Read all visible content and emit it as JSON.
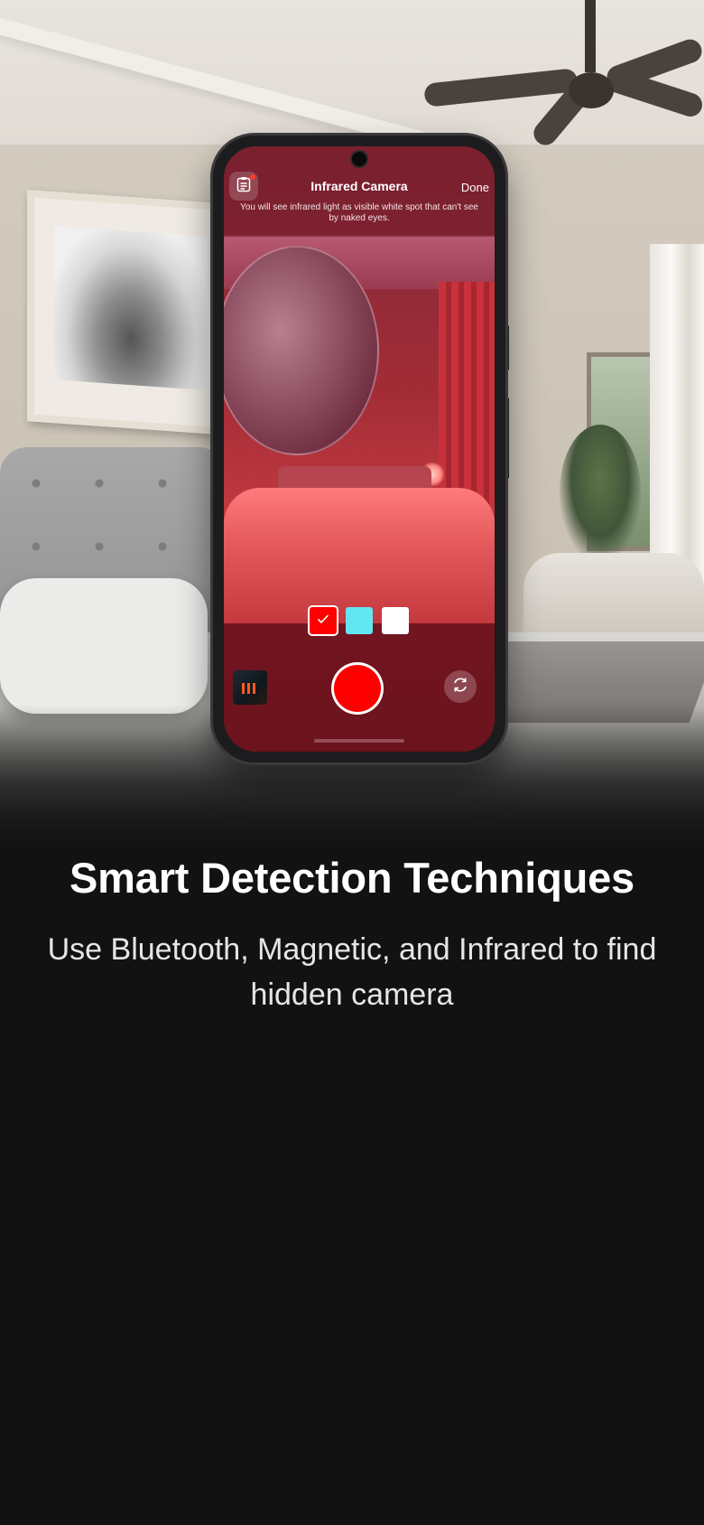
{
  "screen": {
    "title": "Infrared Camera",
    "done_label": "Done",
    "subtitle": "You will see infrared light as visible white spot that can't see by naked eyes.",
    "guide_icon": "clipboard-list-icon",
    "flip_icon": "camera-flip-icon",
    "swatches": [
      {
        "name": "red",
        "color": "#ff0000",
        "selected": true
      },
      {
        "name": "cyan",
        "color": "#62e6f2",
        "selected": false
      },
      {
        "name": "white",
        "color": "#ffffff",
        "selected": false
      }
    ],
    "record_color": "#ff0000"
  },
  "onboarding": {
    "headline": "Smart Detection Techniques",
    "description": "Use Bluetooth, Magnetic, and Infrared to find hidden camera"
  },
  "colors": {
    "background": "#121212",
    "accent": "#ff0000"
  }
}
